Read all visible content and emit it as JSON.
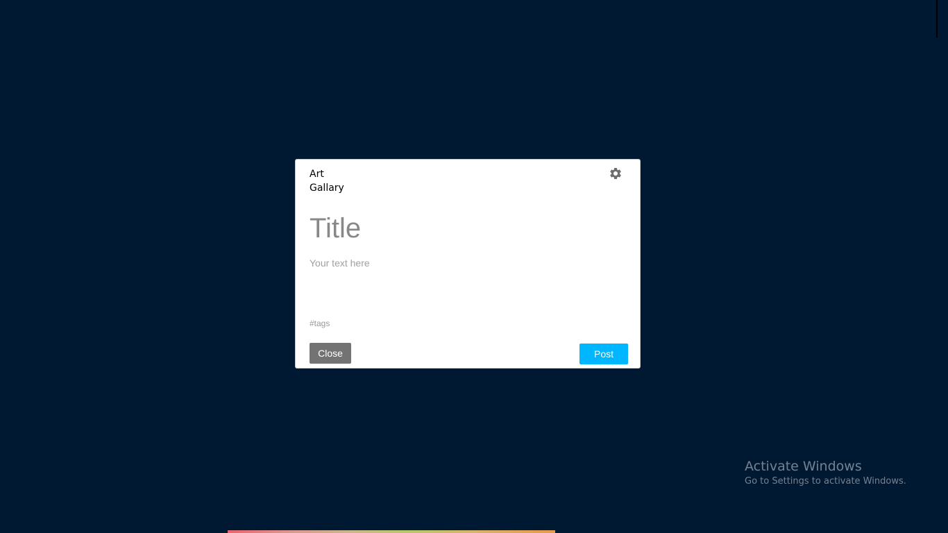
{
  "modal": {
    "brand_line1": "Art",
    "brand_line2": "Gallary",
    "settings_icon": "gear-icon",
    "title_placeholder": "Title",
    "title_value": "",
    "body_placeholder": "Your text here",
    "body_value": "",
    "tags_placeholder": "#tags",
    "tags_value": "",
    "close_label": "Close",
    "post_label": "Post"
  },
  "watermark": {
    "title": "Activate Windows",
    "subtitle": "Go to Settings to activate Windows."
  },
  "colors": {
    "background": "#001933",
    "post_button": "#00b6ff",
    "close_button": "#737373"
  }
}
